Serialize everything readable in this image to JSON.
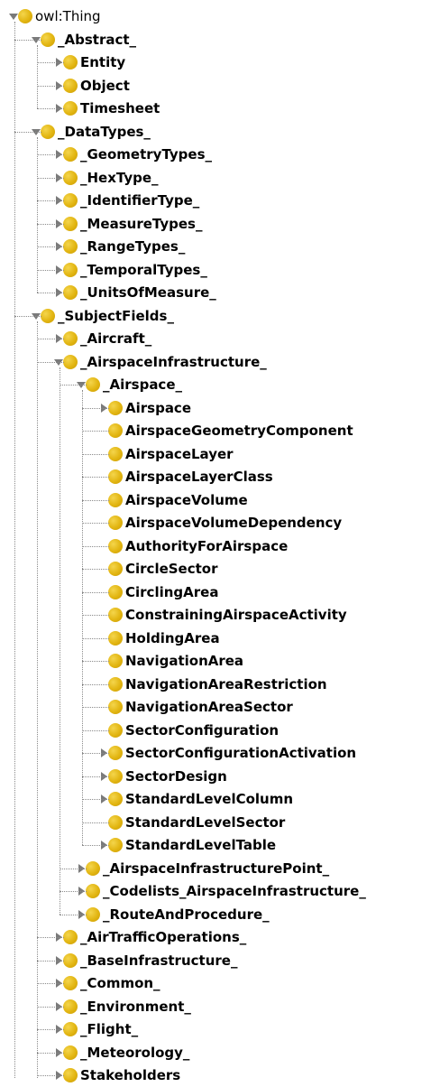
{
  "colors": {
    "class_icon": "#e2b511",
    "connector": "#8a8a8a",
    "toggle": "#7a7a7a"
  },
  "icons": {
    "class_icon": "class-circle-icon",
    "expanded_toggle": "expand-triangle-down-icon",
    "collapsed_toggle": "collapse-triangle-right-icon"
  },
  "tree": [
    {
      "label": "owl:Thing",
      "depth": 0,
      "toggle": "expanded"
    },
    {
      "label": "_Abstract_",
      "depth": 1,
      "toggle": "expanded"
    },
    {
      "label": "Entity",
      "depth": 2,
      "toggle": "collapsed"
    },
    {
      "label": "Object",
      "depth": 2,
      "toggle": "collapsed"
    },
    {
      "label": "Timesheet",
      "depth": 2,
      "toggle": "collapsed"
    },
    {
      "label": "_DataTypes_",
      "depth": 1,
      "toggle": "expanded"
    },
    {
      "label": "_GeometryTypes_",
      "depth": 2,
      "toggle": "collapsed"
    },
    {
      "label": "_HexType_",
      "depth": 2,
      "toggle": "collapsed"
    },
    {
      "label": "_IdentifierType_",
      "depth": 2,
      "toggle": "collapsed"
    },
    {
      "label": "_MeasureTypes_",
      "depth": 2,
      "toggle": "collapsed"
    },
    {
      "label": "_RangeTypes_",
      "depth": 2,
      "toggle": "collapsed"
    },
    {
      "label": "_TemporalTypes_",
      "depth": 2,
      "toggle": "collapsed"
    },
    {
      "label": "_UnitsOfMeasure_",
      "depth": 2,
      "toggle": "collapsed"
    },
    {
      "label": "_SubjectFields_",
      "depth": 1,
      "toggle": "expanded"
    },
    {
      "label": "_Aircraft_",
      "depth": 2,
      "toggle": "collapsed"
    },
    {
      "label": "_AirspaceInfrastructure_",
      "depth": 2,
      "toggle": "expanded"
    },
    {
      "label": "_Airspace_",
      "depth": 3,
      "toggle": "expanded"
    },
    {
      "label": "Airspace",
      "depth": 4,
      "toggle": "collapsed"
    },
    {
      "label": "AirspaceGeometryComponent",
      "depth": 4,
      "toggle": "none"
    },
    {
      "label": "AirspaceLayer",
      "depth": 4,
      "toggle": "none"
    },
    {
      "label": "AirspaceLayerClass",
      "depth": 4,
      "toggle": "none"
    },
    {
      "label": "AirspaceVolume",
      "depth": 4,
      "toggle": "none"
    },
    {
      "label": "AirspaceVolumeDependency",
      "depth": 4,
      "toggle": "none"
    },
    {
      "label": "AuthorityForAirspace",
      "depth": 4,
      "toggle": "none"
    },
    {
      "label": "CircleSector",
      "depth": 4,
      "toggle": "none"
    },
    {
      "label": "CirclingArea",
      "depth": 4,
      "toggle": "none"
    },
    {
      "label": "ConstrainingAirspaceActivity",
      "depth": 4,
      "toggle": "none"
    },
    {
      "label": "HoldingArea",
      "depth": 4,
      "toggle": "none"
    },
    {
      "label": "NavigationArea",
      "depth": 4,
      "toggle": "none"
    },
    {
      "label": "NavigationAreaRestriction",
      "depth": 4,
      "toggle": "none"
    },
    {
      "label": "NavigationAreaSector",
      "depth": 4,
      "toggle": "none"
    },
    {
      "label": "SectorConfiguration",
      "depth": 4,
      "toggle": "none"
    },
    {
      "label": "SectorConfigurationActivation",
      "depth": 4,
      "toggle": "collapsed"
    },
    {
      "label": "SectorDesign",
      "depth": 4,
      "toggle": "collapsed"
    },
    {
      "label": "StandardLevelColumn",
      "depth": 4,
      "toggle": "collapsed"
    },
    {
      "label": "StandardLevelSector",
      "depth": 4,
      "toggle": "none"
    },
    {
      "label": "StandardLevelTable",
      "depth": 4,
      "toggle": "collapsed"
    },
    {
      "label": "_AirspaceInfrastructurePoint_",
      "depth": 3,
      "toggle": "collapsed"
    },
    {
      "label": "_Codelists_AirspaceInfrastructure_",
      "depth": 3,
      "toggle": "collapsed"
    },
    {
      "label": "_RouteAndProcedure_",
      "depth": 3,
      "toggle": "collapsed"
    },
    {
      "label": "_AirTrafficOperations_",
      "depth": 2,
      "toggle": "collapsed"
    },
    {
      "label": "_BaseInfrastructure_",
      "depth": 2,
      "toggle": "collapsed"
    },
    {
      "label": "_Common_",
      "depth": 2,
      "toggle": "collapsed"
    },
    {
      "label": "_Environment_",
      "depth": 2,
      "toggle": "collapsed"
    },
    {
      "label": "_Flight_",
      "depth": 2,
      "toggle": "collapsed"
    },
    {
      "label": "_Meteorology_",
      "depth": 2,
      "toggle": "collapsed"
    },
    {
      "label": "Stakeholders",
      "depth": 2,
      "toggle": "collapsed"
    }
  ]
}
